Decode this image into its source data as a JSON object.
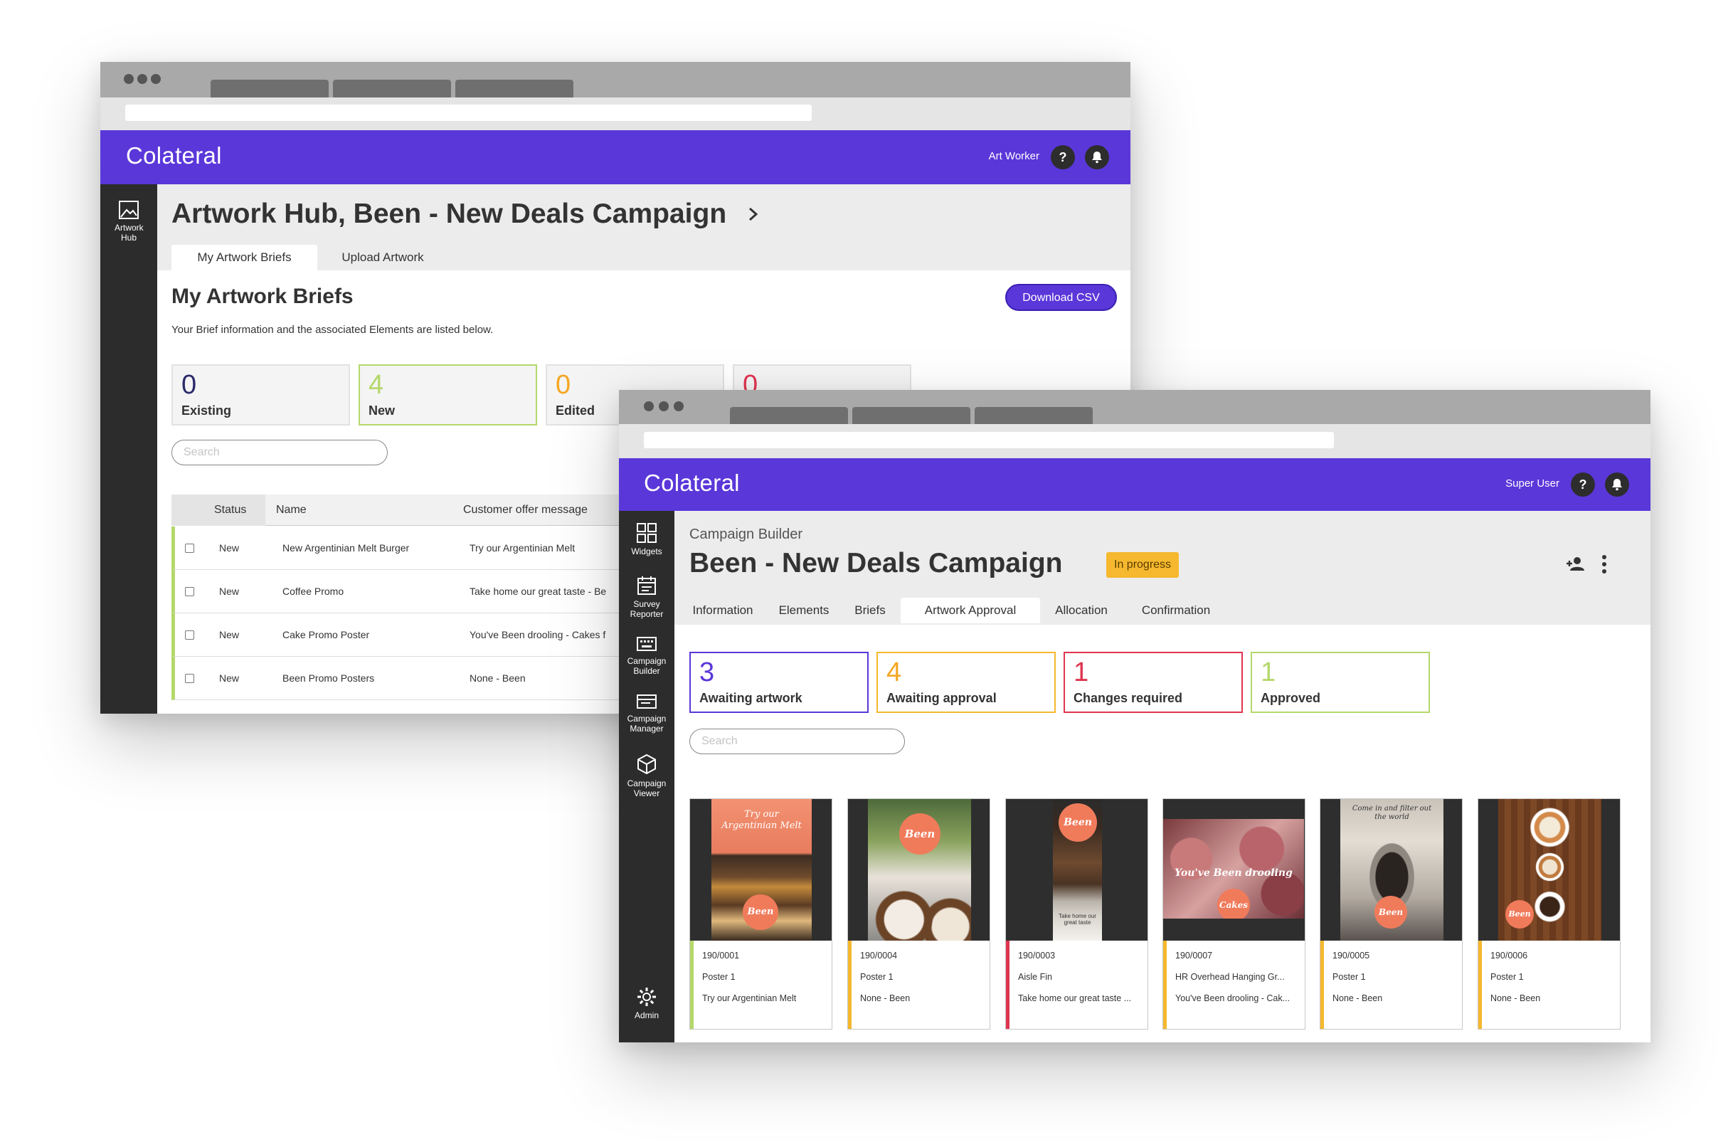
{
  "colors": {
    "purple": "#5a37d9",
    "dark_sidebar": "#2c2c2c",
    "existing": "#2b2a6b",
    "new_green": "#b4d86a",
    "edited_orange": "#f5a623",
    "red": "#e0344f",
    "awaiting_artwork": "#5a37d9",
    "awaiting_approval": "#f5b82e",
    "changes_required": "#e0344f",
    "approved": "#b4d86a"
  },
  "back_window": {
    "brand": "Colateral",
    "user_name": "Art Worker",
    "help_icon": "?",
    "sidebar": {
      "items": [
        {
          "label": "Artwork Hub",
          "icon": "image-icon"
        }
      ]
    },
    "page_title": "Artwork Hub, Been - New Deals Campaign",
    "tabs": [
      {
        "label": "My Artwork Briefs",
        "active": true
      },
      {
        "label": "Upload Artwork",
        "active": false
      }
    ],
    "section_title": "My Artwork Briefs",
    "download_label": "Download CSV",
    "subtitle": "Your Brief information and the associated Elements are listed below.",
    "cards": [
      {
        "count": "0",
        "label": "Existing"
      },
      {
        "count": "4",
        "label": "New"
      },
      {
        "count": "0",
        "label": "Edited"
      },
      {
        "count": "0",
        "label": ""
      }
    ],
    "search_placeholder": "Search",
    "table": {
      "headers": [
        "Status",
        "Name",
        "Customer offer message"
      ],
      "rows": [
        {
          "status": "New",
          "name": "New Argentinian Melt Burger",
          "message": "Try our Argentinian Melt"
        },
        {
          "status": "New",
          "name": "Coffee Promo",
          "message": "Take home our great taste - Be"
        },
        {
          "status": "New",
          "name": "Cake Promo Poster",
          "message": "You've Been drooling - Cakes f"
        },
        {
          "status": "New",
          "name": "Been Promo Posters",
          "message": "None - Been"
        }
      ]
    }
  },
  "front_window": {
    "brand": "Colateral",
    "user_name": "Super User",
    "help_icon": "?",
    "sidebar": {
      "items": [
        {
          "label": "Widgets",
          "icon": "grid-icon"
        },
        {
          "label": "Survey Reporter",
          "icon": "calendar-icon"
        },
        {
          "label": "Campaign Builder",
          "icon": "keyboard-icon"
        },
        {
          "label": "Campaign Manager",
          "icon": "folder-icon"
        },
        {
          "label": "Campaign Viewer",
          "icon": "cube-icon"
        }
      ],
      "admin_label": "Admin"
    },
    "breadcrumb": "Campaign Builder",
    "page_title": "Been - New Deals Campaign",
    "status_badge": "In progress",
    "tabs": [
      {
        "label": "Information",
        "active": false
      },
      {
        "label": "Elements",
        "active": false
      },
      {
        "label": "Briefs",
        "active": false
      },
      {
        "label": "Artwork Approval",
        "active": true
      },
      {
        "label": "Allocation",
        "active": false
      },
      {
        "label": "Confirmation",
        "active": false
      }
    ],
    "cards": [
      {
        "count": "3",
        "label": "Awaiting artwork"
      },
      {
        "count": "4",
        "label": "Awaiting approval"
      },
      {
        "count": "1",
        "label": "Changes required"
      },
      {
        "count": "1",
        "label": "Approved"
      }
    ],
    "search_placeholder": "Search",
    "artworks": [
      {
        "id": "190/0001",
        "type": "Poster 1",
        "message": "Try our Argentinian Melt",
        "status_color": "#b4d86a",
        "poster_text": "Try our Argentinian Melt",
        "blob": "Been"
      },
      {
        "id": "190/0004",
        "type": "Poster 1",
        "message": "None - Been",
        "status_color": "#f5b82e",
        "poster_text": "",
        "blob": "Been"
      },
      {
        "id": "190/0003",
        "type": "Aisle Fin",
        "message": "Take home our great taste ...",
        "status_color": "#e0344f",
        "poster_text": "Take home our great taste",
        "blob": "Been"
      },
      {
        "id": "190/0007",
        "type": "HR Overhead Hanging Gr...",
        "message": "You've Been drooling - Cak...",
        "status_color": "#f5b82e",
        "poster_text": "You've Been drooling",
        "blob": "Cakes"
      },
      {
        "id": "190/0005",
        "type": "Poster 1",
        "message": "None - Been",
        "status_color": "#f5b82e",
        "poster_text": "Come in and filter out the world",
        "blob": "Been"
      },
      {
        "id": "190/0006",
        "type": "Poster 1",
        "message": "None - Been",
        "status_color": "#f5b82e",
        "poster_text": "",
        "blob": "Been"
      }
    ]
  }
}
